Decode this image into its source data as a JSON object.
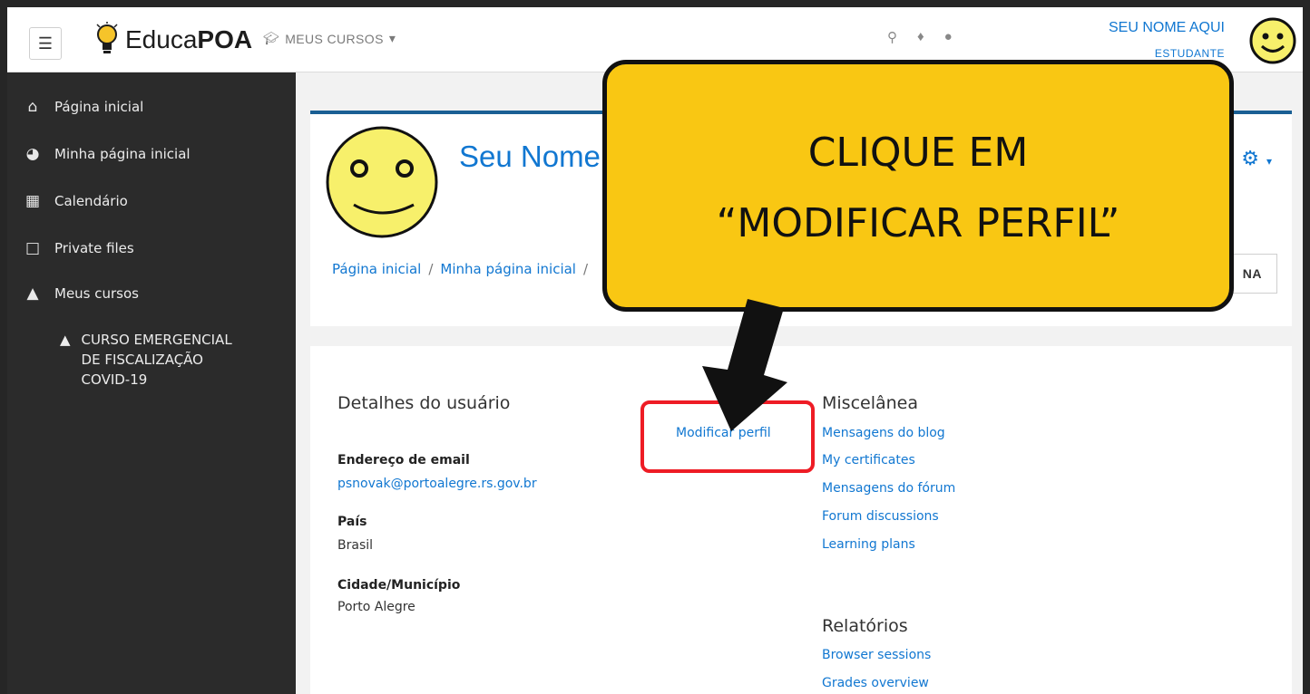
{
  "navbar": {
    "logo_text_regular": "Educa",
    "logo_text_bold": "POA",
    "courses_label": "MEUS CURSOS",
    "user_name": "SEU NOME AQUI",
    "user_role": "ESTUDANTE"
  },
  "sidebar": {
    "items": [
      {
        "label": "Página inicial",
        "icon": "home-icon"
      },
      {
        "label": "Minha página inicial",
        "icon": "dashboard-icon"
      },
      {
        "label": "Calendário",
        "icon": "calendar-icon"
      },
      {
        "label": "Private files",
        "icon": "file-icon"
      },
      {
        "label": "Meus cursos",
        "icon": "graduation-cap-icon"
      }
    ],
    "course": "CURSO EMERGENCIAL DE FISCALIZAÇÃO COVID-19"
  },
  "header": {
    "profile_name": "Seu Nome",
    "breadcrumb": [
      "Página inicial",
      "Minha página inicial"
    ],
    "button_partial": "NA"
  },
  "details": {
    "title": "Detalhes do usuário",
    "modify_link": "Modificar perfil",
    "email_label": "Endereço de email",
    "email_value": "psnovak@portoalegre.rs.gov.br",
    "country_label": "País",
    "country_value": "Brasil",
    "city_label": "Cidade/Município",
    "city_value": "Porto Alegre"
  },
  "misc": {
    "title": "Miscelânea",
    "links": [
      "Mensagens do blog",
      "My certificates",
      "Mensagens do fórum",
      "Forum discussions",
      "Learning plans"
    ]
  },
  "reports": {
    "title": "Relatórios",
    "links": [
      "Browser sessions",
      "Grades overview"
    ]
  },
  "callout": {
    "line1": "CLIQUE EM",
    "line2": "“MODIFICAR PERFIL”"
  },
  "colors": {
    "link": "#1177d1",
    "callout": "#f9c713",
    "highlight": "#ee1c25",
    "sidebar": "#2b2b2b"
  }
}
